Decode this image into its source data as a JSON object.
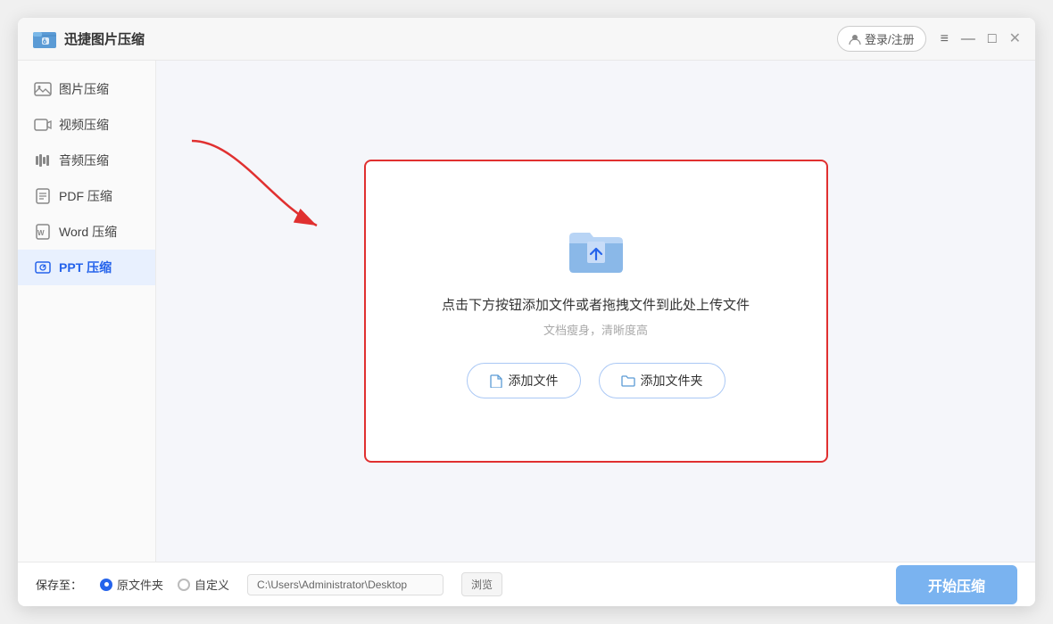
{
  "app": {
    "title": "迅捷图片压缩",
    "login_label": "登录/注册"
  },
  "window_controls": {
    "menu": "≡",
    "minimize": "—",
    "maximize": "□",
    "close": "✕"
  },
  "sidebar": {
    "items": [
      {
        "id": "image",
        "label": "图片压缩",
        "active": false
      },
      {
        "id": "video",
        "label": "视频压缩",
        "active": false
      },
      {
        "id": "audio",
        "label": "音频压缩",
        "active": false
      },
      {
        "id": "pdf",
        "label": "PDF 压缩",
        "active": false
      },
      {
        "id": "word",
        "label": "Word 压缩",
        "active": false
      },
      {
        "id": "ppt",
        "label": "PPT 压缩",
        "active": true
      }
    ]
  },
  "dropzone": {
    "main_text": "点击下方按钮添加文件或者拖拽文件到此处上传文件",
    "sub_text": "文档瘦身，清晰度高",
    "add_file_label": "添加文件",
    "add_folder_label": "添加文件夹"
  },
  "footer": {
    "save_label": "保存至：",
    "option_original": "原文件夹",
    "option_custom": "自定义",
    "path_value": "C:\\Users\\Administrator\\Desktop",
    "browse_label": "浏览",
    "start_label": "开始压缩"
  }
}
